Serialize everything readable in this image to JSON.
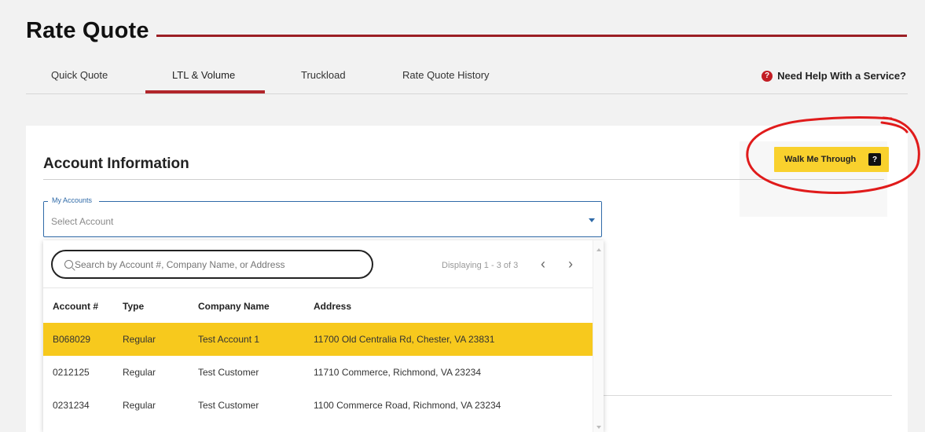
{
  "page": {
    "title": "Rate Quote"
  },
  "tabs": [
    {
      "label": "Quick Quote"
    },
    {
      "label": "LTL & Volume",
      "active": true
    },
    {
      "label": "Truckload"
    },
    {
      "label": "Rate Quote History"
    }
  ],
  "help": {
    "label": "Need Help With a Service?",
    "icon": "?"
  },
  "account_section": {
    "title": "Account Information",
    "walk_button": {
      "label": "Walk Me Through",
      "icon": "?"
    }
  },
  "account_select": {
    "label": "My Accounts",
    "placeholder": "Select Account"
  },
  "dropdown": {
    "search_placeholder": "Search by Account #, Company Name, or Address",
    "paging_text": "Displaying 1 - 3 of 3",
    "prev_icon": "‹",
    "next_icon": "›",
    "columns": [
      "Account #",
      "Type",
      "Company Name",
      "Address"
    ],
    "rows": [
      {
        "account": "B068029",
        "type": "Regular",
        "company": "Test Account 1",
        "address": "11700 Old Centralia Rd, Chester, VA 23831",
        "selected": true
      },
      {
        "account": "0212125",
        "type": "Regular",
        "company": "Test Customer",
        "address": "11710 Commerce, Richmond, VA 23234"
      },
      {
        "account": "0231234",
        "type": "Regular",
        "company": "Test Customer",
        "address": "1100 Commerce Road, Richmond, VA 23234"
      }
    ]
  },
  "colors": {
    "brand_red": "#b1252a",
    "highlight_yellow": "#f7c91d",
    "button_yellow": "#f9d12d",
    "select_blue": "#2f6aa8",
    "annotation_red": "#e01b1b"
  }
}
